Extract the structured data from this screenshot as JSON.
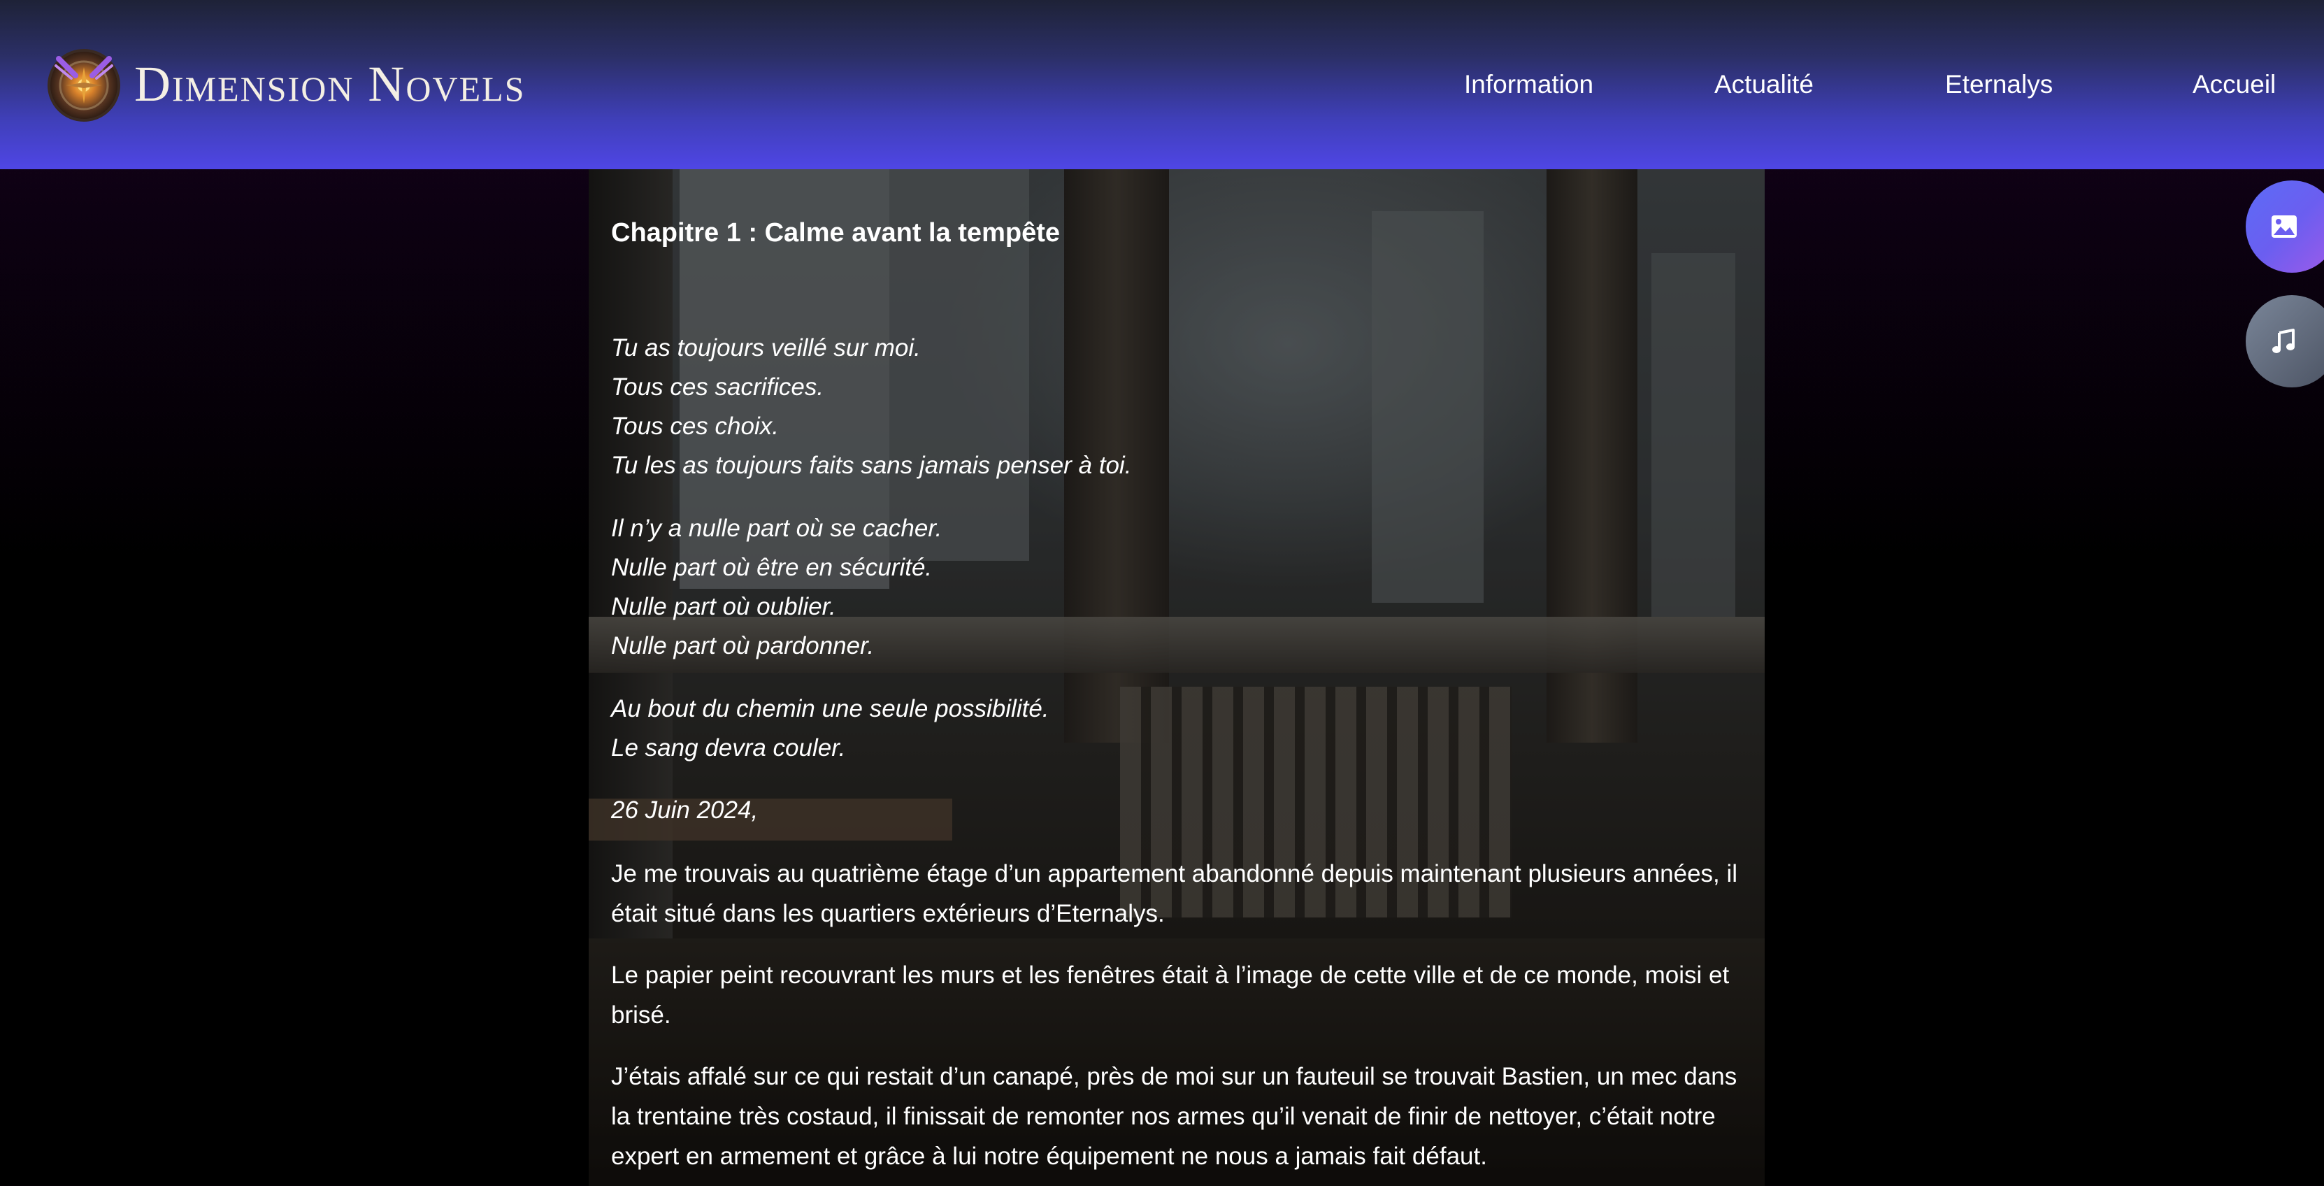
{
  "header": {
    "brand": "Dimension Novels",
    "nav": [
      {
        "label": "Information"
      },
      {
        "label": "Actualité"
      },
      {
        "label": "Eternalys"
      },
      {
        "label": "Accueil"
      }
    ]
  },
  "floating_buttons": [
    {
      "icon": "image-icon"
    },
    {
      "icon": "music-note-icon"
    }
  ],
  "chapter": {
    "title": "Chapitre 1 : Calme avant la tempête",
    "poem": [
      "Tu as toujours veillé sur moi.",
      "Tous ces sacrifices.",
      "Tous ces choix.",
      "Tu les as toujours faits sans jamais penser à toi.",
      "Il n’y a nulle part où se cacher.",
      "Nulle part où être en sécurité.",
      "Nulle part où oublier.",
      "Nulle part où pardonner.",
      "Au bout du chemin une seule possibilité.",
      "Le sang devra couler."
    ],
    "date": "26 Juin 2024,",
    "paragraphs": [
      "Je me trouvais au quatrième étage d’un appartement abandonné depuis maintenant plusieurs années, il était situé dans les quartiers extérieurs d’Eternalys.",
      "Le papier peint recouvrant les murs et les fenêtres était à l’image de cette ville et de ce monde, moisi et brisé.",
      "J’étais affalé sur ce qui restait d’un canapé, près de moi sur un fauteuil se trouvait Bastien, un mec dans la trentaine très costaud, il finissait de remonter nos armes qu’il venait de finir de nettoyer, c’était notre expert en armement et grâce à lui notre équipement ne nous a jamais fait défaut."
    ]
  },
  "colors": {
    "header_top": "#1e2237",
    "header_bottom": "#4f46e5",
    "float_image": "#6b5ef0",
    "float_music": "#5e6778",
    "text": "#ffffff"
  }
}
